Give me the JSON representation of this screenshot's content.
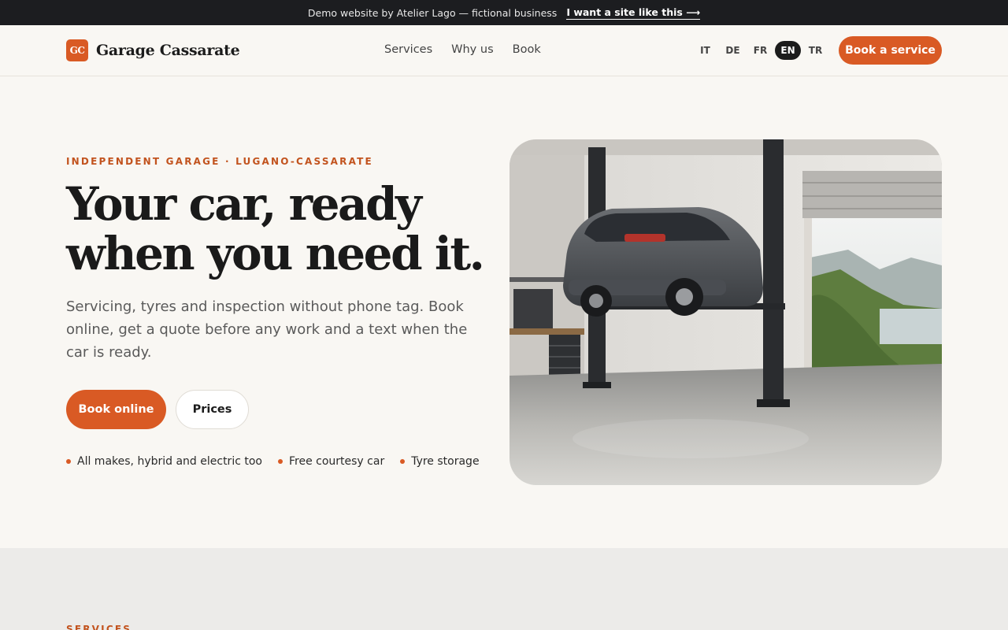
{
  "banner": {
    "text": "Demo website by Atelier Lago — fictional business",
    "link": "I want a site like this ⟶"
  },
  "header": {
    "logo_initials": "GC",
    "brand_name": "Garage Cassarate",
    "nav": [
      "Services",
      "Why us",
      "Book"
    ],
    "languages": [
      "IT",
      "DE",
      "FR",
      "EN",
      "TR"
    ],
    "active_language": "EN",
    "cta": "Book a service"
  },
  "hero": {
    "eyebrow": "INDEPENDENT GARAGE · LUGANO-CASSARATE",
    "headline_line1": "Your car, ready",
    "headline_line2": "when you need it.",
    "lead": "Servicing, tyres and inspection without phone tag. Book online, get a quote before any work and a text when the car is ready.",
    "primary_cta": "Book online",
    "secondary_cta": "Prices",
    "features": [
      "All makes, hybrid and electric too",
      "Free courtesy car",
      "Tyre storage"
    ]
  },
  "services": {
    "eyebrow": "SERVICES"
  },
  "colors": {
    "accent": "#d95a24",
    "banner_bg": "#1c1d20",
    "page_bg": "#f9f7f3",
    "band_bg": "#ecebe9"
  }
}
